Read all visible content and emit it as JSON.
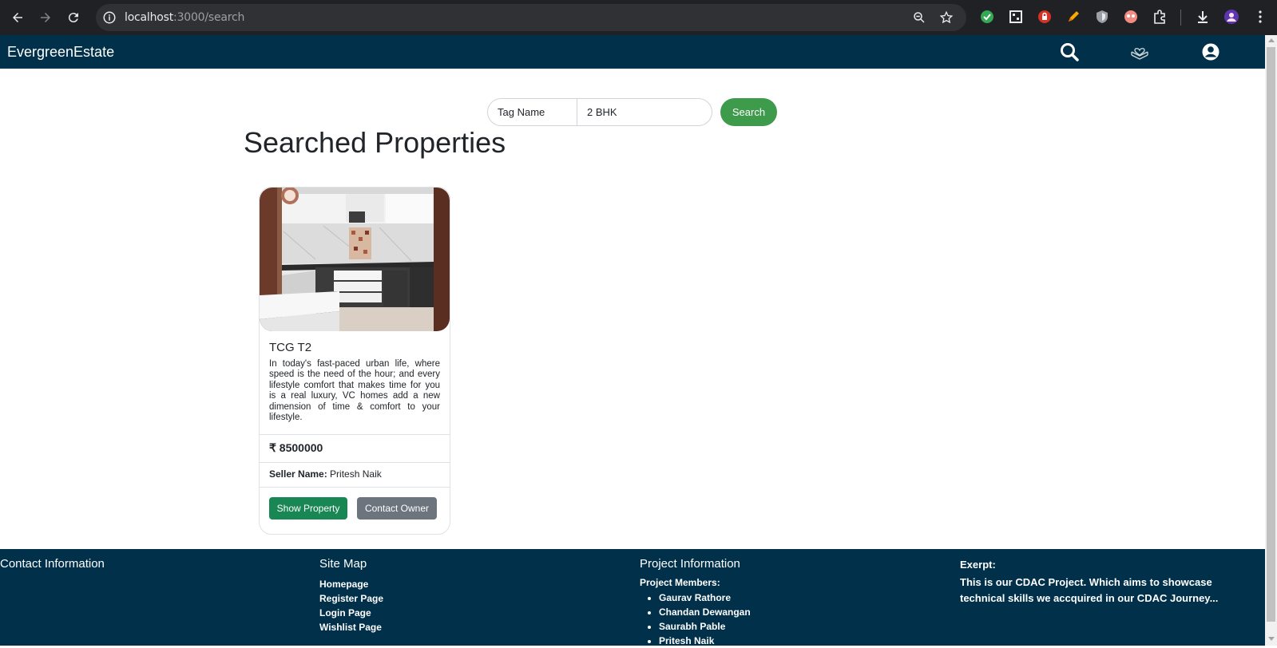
{
  "browser": {
    "url_host": "localhost",
    "url_path": ":3000/search"
  },
  "header": {
    "brand": "EvergreenEstate"
  },
  "search": {
    "tag_select_value": "Tag Name",
    "query_value": "2 BHK",
    "button_label": "Search"
  },
  "main": {
    "title": "Searched Properties"
  },
  "property": {
    "title": "TCG T2",
    "description": "In today's fast-paced urban life, where speed is the need of the hour; and every lifestyle comfort that makes time for you is a real luxury, VC homes add a new dimension of time & comfort to your lifestyle.",
    "price": "₹ 8500000",
    "seller_label": "Seller Name:",
    "seller_name": "Pritesh Naik",
    "show_button": "Show Property",
    "contact_button": "Contact Owner"
  },
  "footer": {
    "contact_heading": "Contact Information",
    "sitemap_heading": "Site Map",
    "sitemap_links": [
      "Homepage",
      "Register Page",
      "Login Page",
      "Wishlist Page"
    ],
    "project_heading": "Project Information",
    "members_label": "Project Members:",
    "members": [
      "Gaurav Rathore",
      "Chandan Dewangan",
      "Saurabh Pable",
      "Pritesh Naik"
    ],
    "exerpt_heading": "Exerpt:",
    "exerpt_text": "This is our CDAC Project. Which aims to showcase technical skills we accquired in our CDAC Journey..."
  },
  "colors": {
    "header_bg": "#00304a",
    "search_btn": "#3e9b4b",
    "show_btn": "#198754",
    "contact_btn": "#6c757d"
  }
}
